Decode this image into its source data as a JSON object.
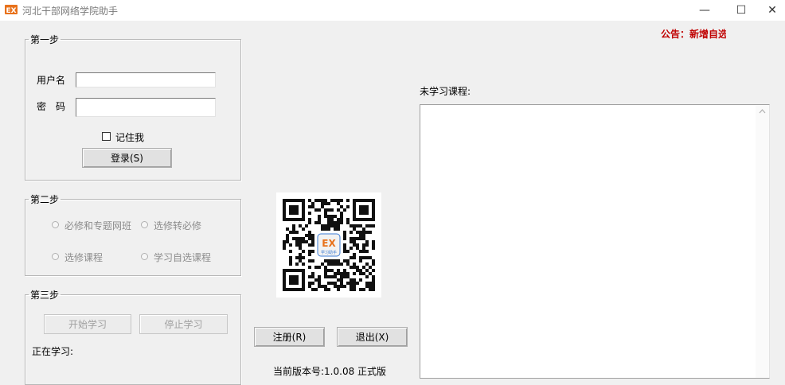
{
  "window": {
    "title": "河北干部网络学院助手",
    "controls": {
      "minimize": "—",
      "maximize": "☐",
      "close": "✕"
    },
    "logo_text": "EX",
    "logo_color": "#e8711a"
  },
  "announcement": "公告：新增自选",
  "step1": {
    "legend": "第一步",
    "username_label": "用户名",
    "username_value": "",
    "password_label": "密　码",
    "password_value": "",
    "remember_label": "记住我",
    "remember_checked": false,
    "login_button": "登录(S)"
  },
  "step2": {
    "legend": "第二步",
    "options": [
      "必修和专题网班",
      "选修转必修",
      "选修课程",
      "学习自选课程"
    ]
  },
  "step3": {
    "legend": "第三步",
    "start_button": "开始学习",
    "stop_button": "停止学习",
    "current_label": "正在学习:"
  },
  "register_button": "注册(R)",
  "exit_button": "退出(X)",
  "version_text": "当前版本号:1.0.08 正式版",
  "course_list": {
    "label": "未学习课程:",
    "items": []
  },
  "qr": {
    "logo_text": "EX",
    "sub_text": "学习助手"
  }
}
